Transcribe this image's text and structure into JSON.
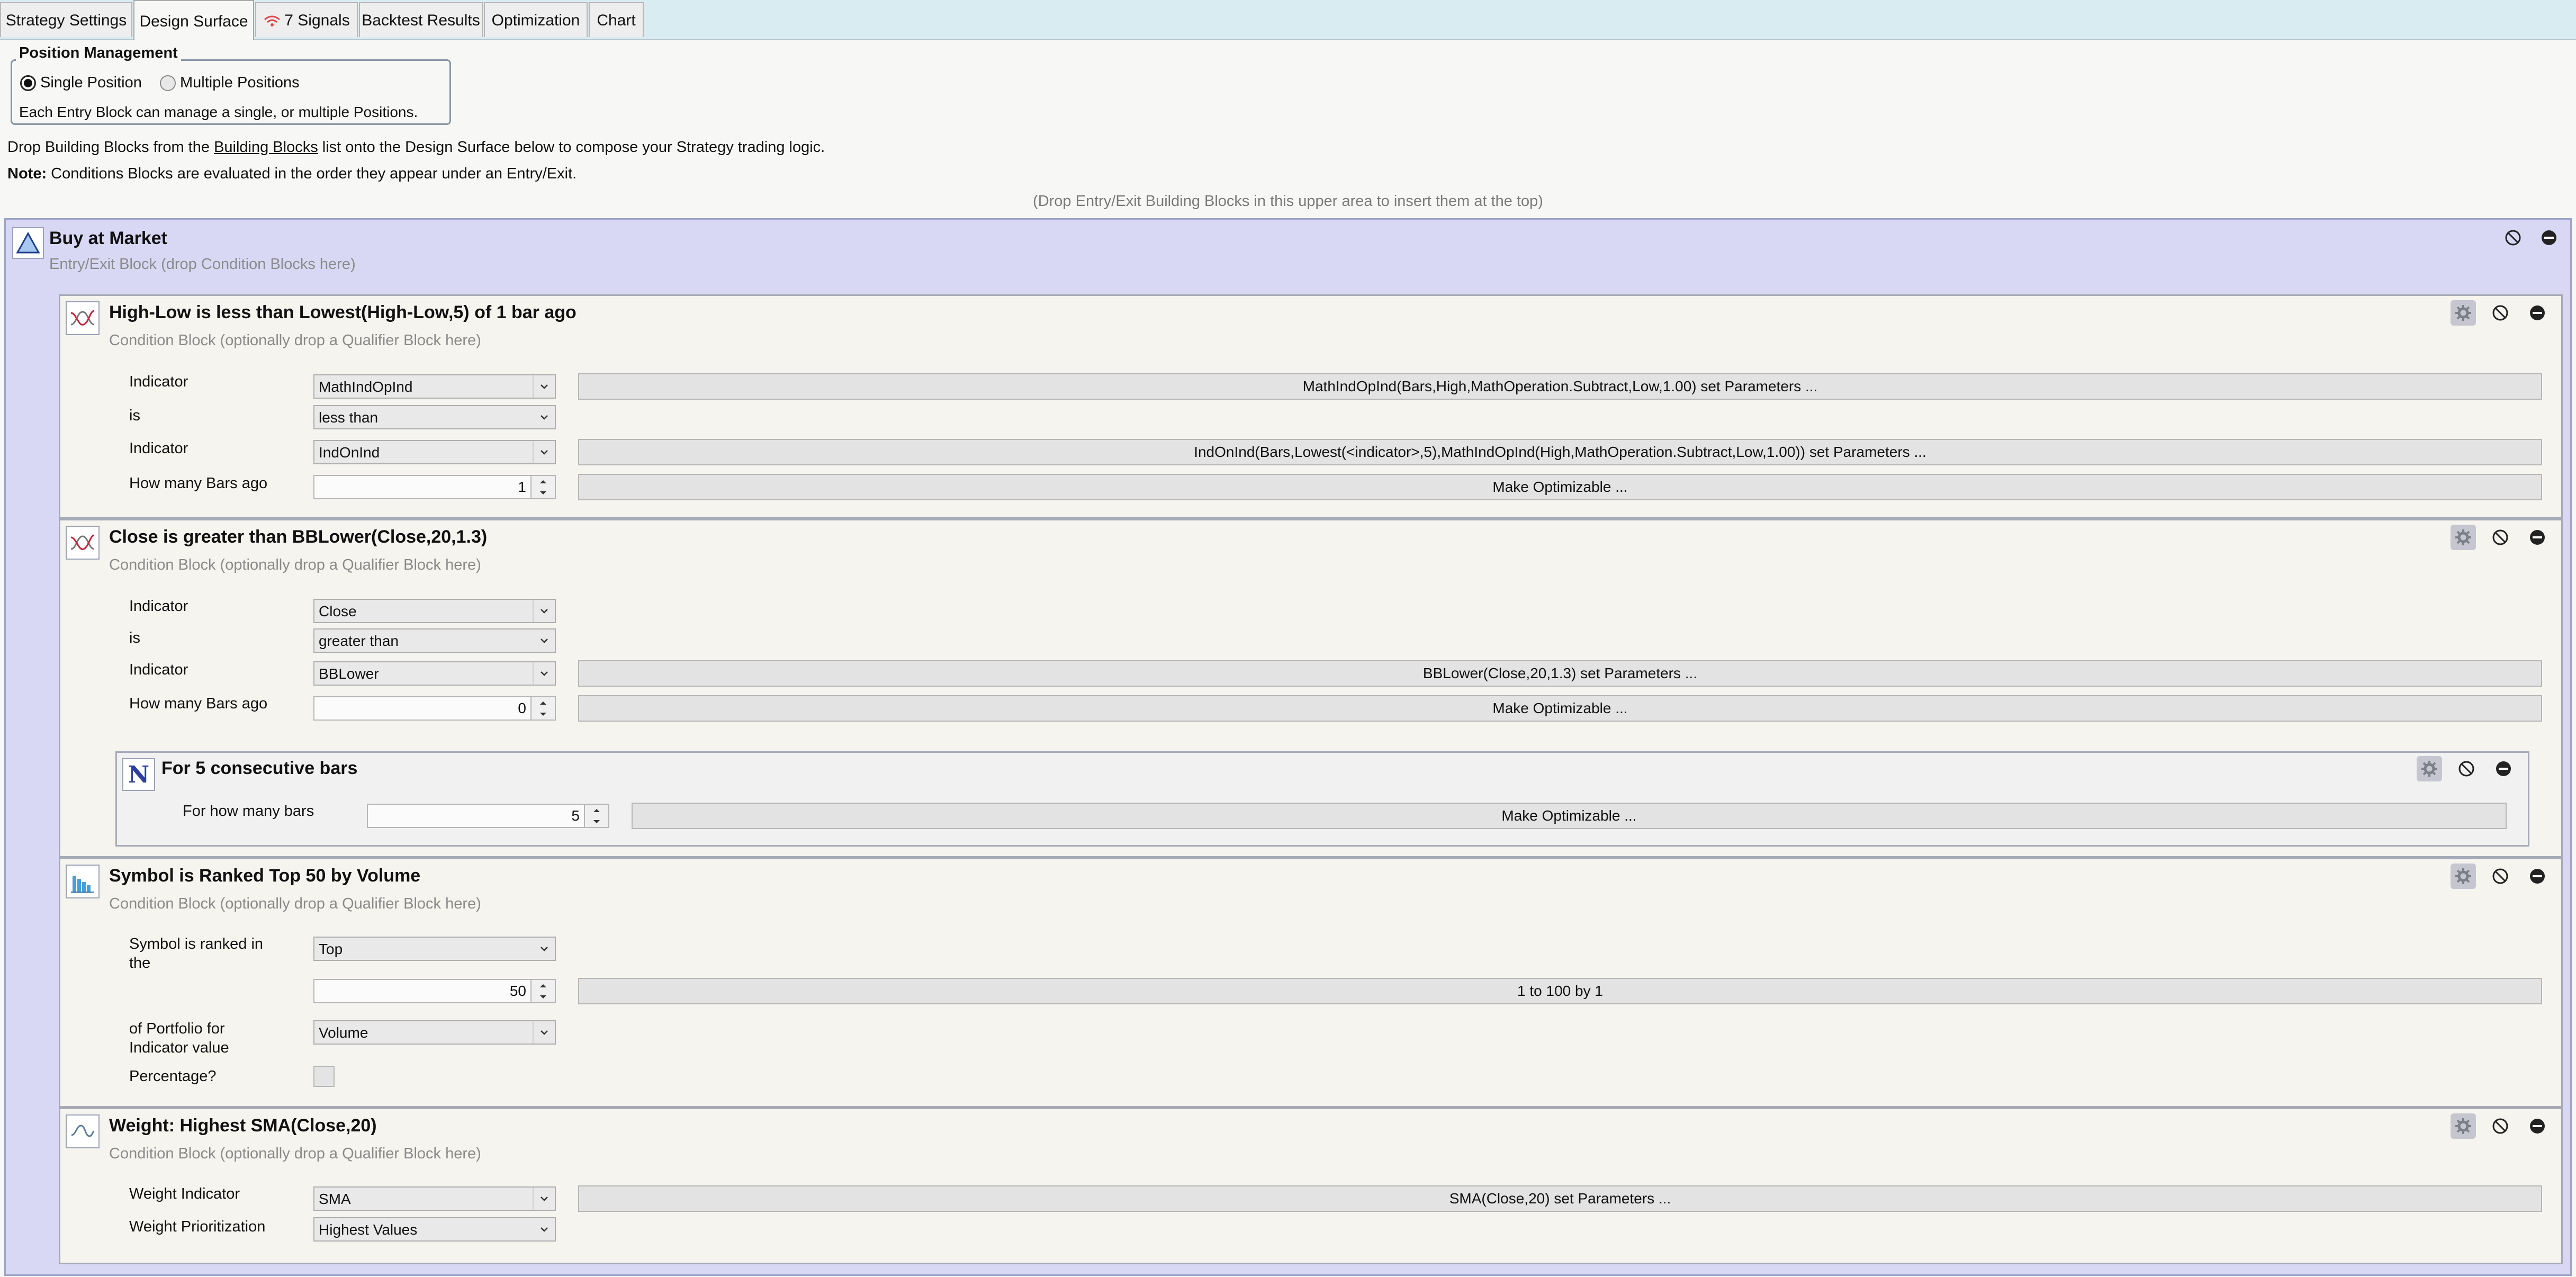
{
  "tabs": [
    {
      "label": "Strategy Settings"
    },
    {
      "label": "Design Surface"
    },
    {
      "label": "7 Signals"
    },
    {
      "label": "Backtest Results"
    },
    {
      "label": "Optimization"
    },
    {
      "label": "Chart"
    }
  ],
  "position_management": {
    "title": "Position Management",
    "single_label": "Single Position",
    "multiple_label": "Multiple Positions",
    "selected": "Single Position",
    "description": "Each Entry Block can manage a single, or multiple Positions."
  },
  "intro": {
    "line1_prefix": "Drop Building Blocks from the ",
    "line1_link": "Building Blocks",
    "line1_suffix": " list onto the Design Surface below to compose your Strategy trading logic.",
    "note_label": "Note:",
    "note_text": " Conditions Blocks are evaluated in the order they appear under an Entry/Exit.",
    "drop_hint": "(Drop Entry/Exit Building Blocks in this upper area to insert them at the top)"
  },
  "entry": {
    "title": "Buy at Market",
    "subtitle": "Entry/Exit Block (drop Condition Blocks here)"
  },
  "condition_subtitle": "Condition Block (optionally drop a Qualifier Block here)",
  "cond1": {
    "title": "High-Low is less than Lowest(High-Low,5) of 1 bar ago",
    "indicator_label": "Indicator",
    "indicator1": "MathIndOpInd",
    "indicator1_params": "MathIndOpInd(Bars,High,MathOperation.Subtract,Low,1.00) set Parameters ...",
    "is_label": "is",
    "comparison": "less than",
    "indicator2": "IndOnInd",
    "indicator2_params": "IndOnInd(Bars,Lowest(<indicator>,5),MathIndOpInd(High,MathOperation.Subtract,Low,1.00)) set Parameters ...",
    "bars_ago_label": "How many Bars ago",
    "bars_ago": "1",
    "make_optimizable": "Make Optimizable ..."
  },
  "cond2": {
    "title": "Close is greater than BBLower(Close,20,1.3)",
    "indicator_label": "Indicator",
    "indicator1": "Close",
    "is_label": "is",
    "comparison": "greater than",
    "indicator2": "BBLower",
    "indicator2_params": "BBLower(Close,20,1.3) set Parameters ...",
    "bars_ago_label": "How many Bars ago",
    "bars_ago": "0",
    "make_optimizable": "Make Optimizable ...",
    "qualifier": {
      "title": "For 5 consecutive bars",
      "bars_label": "For how many bars",
      "bars": "5",
      "make_optimizable": "Make Optimizable ..."
    }
  },
  "cond3": {
    "title": "Symbol is Ranked Top 50 by Volume",
    "ranked_label_1": "Symbol is ranked in",
    "ranked_label_2": "the",
    "rank_dir": "Top",
    "rank_count": "50",
    "range_button": "1 to 100 by 1",
    "portfolio_label_1": "of Portfolio for",
    "portfolio_label_2": "Indicator value",
    "indicator": "Volume",
    "percentage_label": "Percentage?",
    "percentage_checked": false
  },
  "cond4": {
    "title": "Weight: Highest SMA(Close,20)",
    "weight_indicator_label": "Weight Indicator",
    "weight_indicator": "SMA",
    "weight_indicator_params": "SMA(Close,20) set Parameters ...",
    "prioritization_label": "Weight Prioritization",
    "prioritization": "Highest Values"
  },
  "colors": {
    "tab_strip": "#d9ecf2",
    "entry_background": "#d9d8f4",
    "condition_background": "#f6f4ee",
    "signal_icon": "#e0474c"
  },
  "icons": {
    "entry": "triangle-up-icon",
    "condition": "indicator-cross-icon",
    "qualifier": "n-letter-icon",
    "rank": "bar-chart-icon",
    "weight": "sine-wave-icon",
    "settings": "gear-icon",
    "disable": "prohibit-icon",
    "remove": "minus-circle-icon"
  }
}
